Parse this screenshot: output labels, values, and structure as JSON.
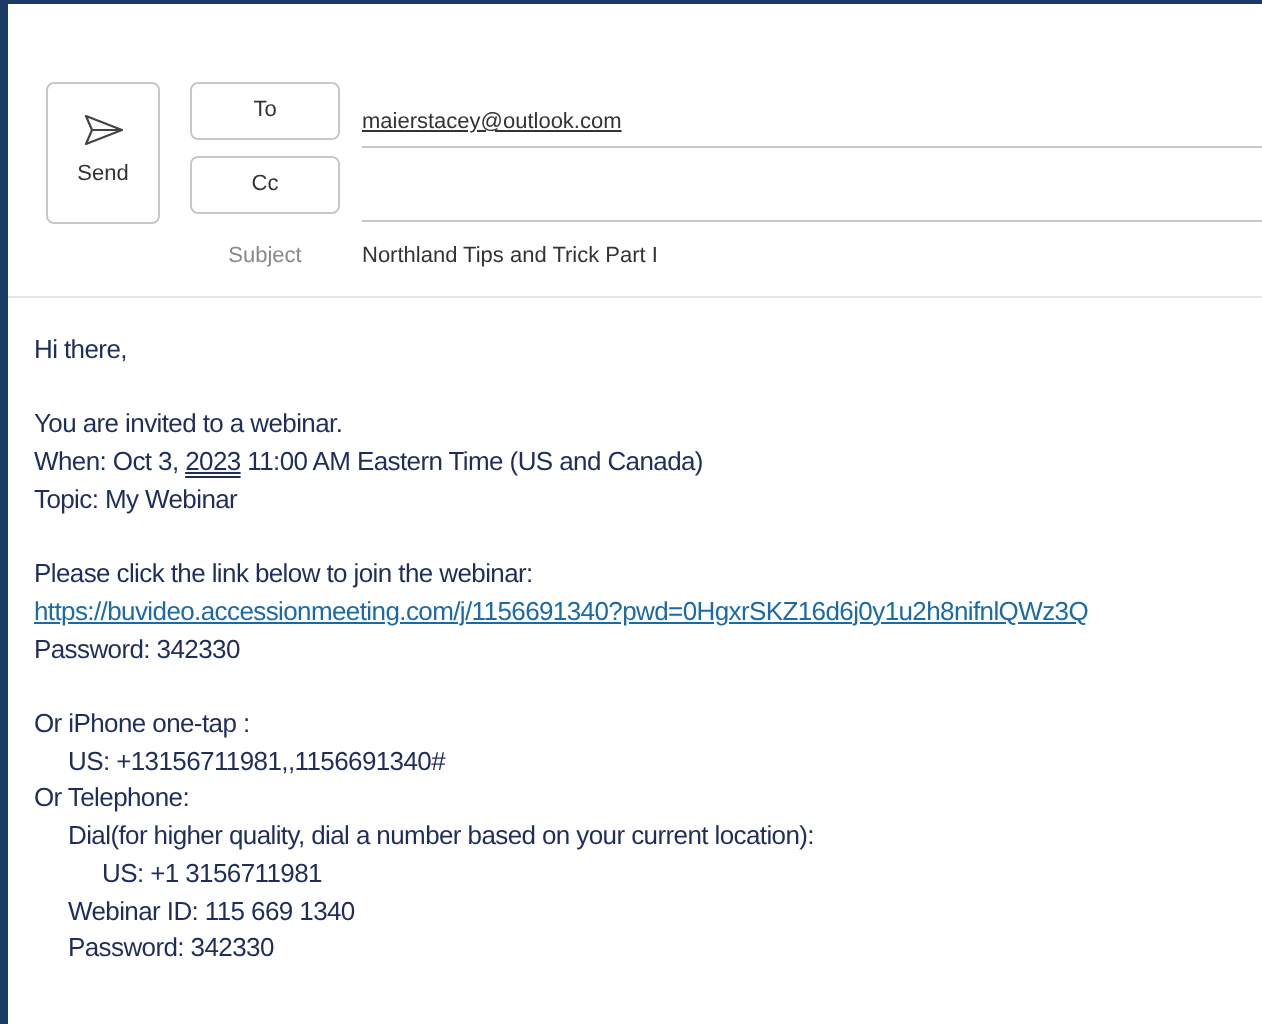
{
  "compose": {
    "send_label": "Send",
    "to_label": "To",
    "to_value": "maierstacey@outlook.com",
    "cc_label": "Cc",
    "subject_label": "Subject",
    "subject_value": "Northland Tips and Trick Part I"
  },
  "body": [
    [
      {
        "segments": [
          {
            "kind": "text",
            "text": "Hi there,"
          }
        ]
      }
    ],
    [
      {
        "segments": [
          {
            "kind": "text",
            "text": "You are invited to a webinar."
          }
        ]
      },
      {
        "segments": [
          {
            "kind": "text",
            "text": "When: Oct 3, "
          },
          {
            "kind": "date",
            "text": "2023"
          },
          {
            "kind": "text",
            "text": " 11:00 AM Eastern Time (US and Canada)"
          }
        ]
      },
      {
        "segments": [
          {
            "kind": "text",
            "text": "Topic: My Webinar"
          }
        ]
      }
    ],
    [
      {
        "segments": [
          {
            "kind": "text",
            "text": "Please click the link below to join the webinar:"
          }
        ]
      },
      {
        "segments": [
          {
            "kind": "link",
            "text": "https://buvideo.accessionmeeting.com/j/1156691340?pwd=0HgxrSKZ16d6j0y1u2h8nifnlQWz3Q"
          }
        ]
      },
      {
        "segments": [
          {
            "kind": "text",
            "text": "Password: 342330"
          }
        ]
      }
    ],
    [
      {
        "segments": [
          {
            "kind": "text",
            "text": "Or iPhone one-tap :"
          }
        ],
        "children": [
          {
            "segments": [
              {
                "kind": "text",
                "text": "US: +13156711981,,1156691340#"
              }
            ]
          }
        ]
      },
      {
        "segments": [
          {
            "kind": "text",
            "text": "Or Telephone:"
          }
        ],
        "children": [
          {
            "segments": [
              {
                "kind": "text",
                "text": "Dial(for higher quality, dial a number based on your current location):"
              }
            ],
            "children": [
              {
                "segments": [
                  {
                    "kind": "text",
                    "text": "US: +1 3156711981"
                  }
                ]
              }
            ]
          },
          {
            "segments": [
              {
                "kind": "text",
                "text": "Webinar ID: 115 669 1340"
              }
            ]
          },
          {
            "segments": [
              {
                "kind": "text",
                "text": "Password: 342330"
              }
            ]
          }
        ]
      }
    ]
  ]
}
